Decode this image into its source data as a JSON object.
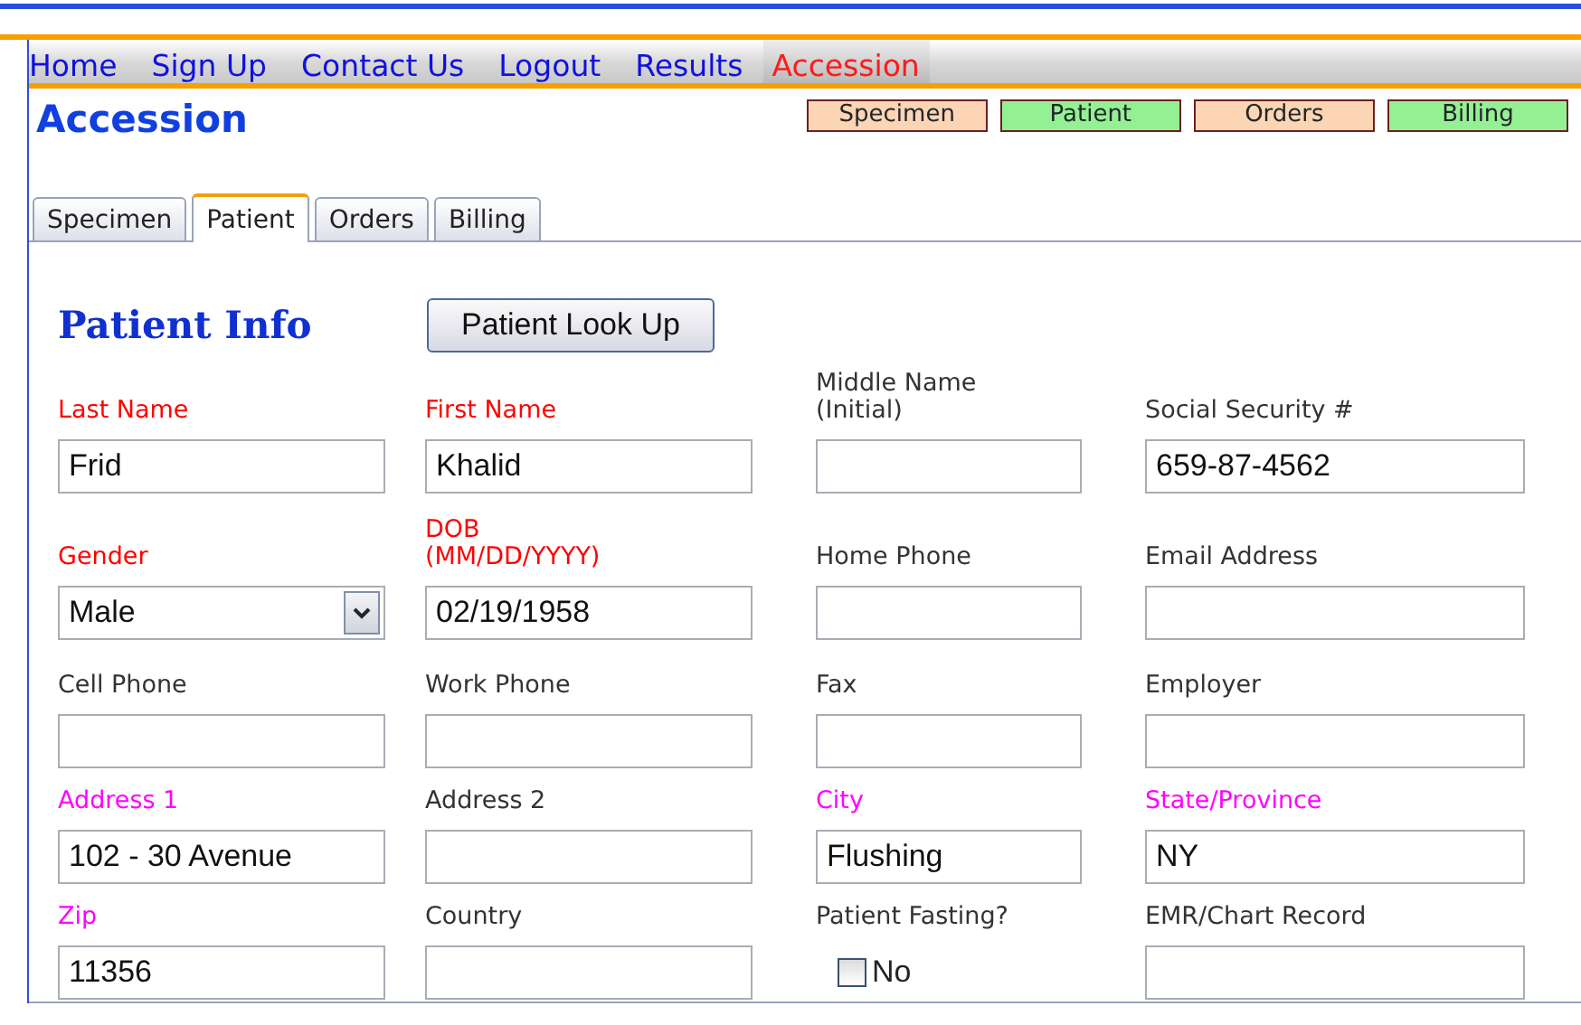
{
  "nav": [
    {
      "label": "Home",
      "selected": false
    },
    {
      "label": "Sign Up",
      "selected": false
    },
    {
      "label": "Contact Us",
      "selected": false
    },
    {
      "label": "Logout",
      "selected": false
    },
    {
      "label": "Results",
      "selected": false
    },
    {
      "label": "Accession",
      "selected": true
    }
  ],
  "page_title": "Accession",
  "status_boxes": [
    {
      "label": "Specimen",
      "color": "#fcd5b4"
    },
    {
      "label": "Patient",
      "color": "#93f193"
    },
    {
      "label": "Orders",
      "color": "#fcd5b4"
    },
    {
      "label": "Billing",
      "color": "#93f193"
    }
  ],
  "tabs": [
    {
      "label": "Specimen",
      "selected": false
    },
    {
      "label": "Patient",
      "selected": true
    },
    {
      "label": "Orders",
      "selected": false
    },
    {
      "label": "Billing",
      "selected": false
    }
  ],
  "section_title": "Patient Info",
  "lookup_button": "Patient Look Up",
  "fields": [
    {
      "label": "Last Name",
      "color": "#ff0000",
      "kind": "text",
      "value": "Frid"
    },
    {
      "label": "First Name",
      "color": "#ff0000",
      "kind": "text",
      "value": "Khalid"
    },
    {
      "label": "Middle Name (Initial)",
      "color": "#333333",
      "kind": "text"
    },
    {
      "label": "Social Security #",
      "color": "#333333",
      "kind": "text",
      "value": "659-87-4562"
    },
    {
      "label": "Gender",
      "color": "#ff0000",
      "kind": "select",
      "value": "Male"
    },
    {
      "label": "DOB (MM/DD/YYYY)",
      "color": "#ff0000",
      "kind": "text",
      "value": "02/19/1958"
    },
    {
      "label": "Home Phone",
      "color": "#333333",
      "kind": "text"
    },
    {
      "label": "Email Address",
      "color": "#333333",
      "kind": "text"
    },
    {
      "label": "Cell Phone",
      "color": "#333333",
      "kind": "text"
    },
    {
      "label": "Work Phone",
      "color": "#333333",
      "kind": "text"
    },
    {
      "label": "Fax",
      "color": "#333333",
      "kind": "text"
    },
    {
      "label": "Employer",
      "color": "#333333",
      "kind": "text"
    },
    {
      "label": "Address 1",
      "color": "#ff00ff",
      "kind": "text",
      "value": "102 - 30 Avenue"
    },
    {
      "label": "Address 2",
      "color": "#333333",
      "kind": "text"
    },
    {
      "label": "City",
      "color": "#ff00ff",
      "kind": "text",
      "value": "Flushing"
    },
    {
      "label": "State/Province",
      "color": "#ff00ff",
      "kind": "text",
      "value": "NY"
    },
    {
      "label": "Zip",
      "color": "#ff00ff",
      "kind": "text",
      "value": "11356"
    },
    {
      "label": "Country",
      "color": "#333333",
      "kind": "text"
    },
    {
      "label": "Patient Fasting?",
      "color": "#333333",
      "kind": "checkbox",
      "option": "No",
      "checked": false
    },
    {
      "label": "EMR/Chart Record",
      "color": "#333333",
      "kind": "text"
    }
  ]
}
